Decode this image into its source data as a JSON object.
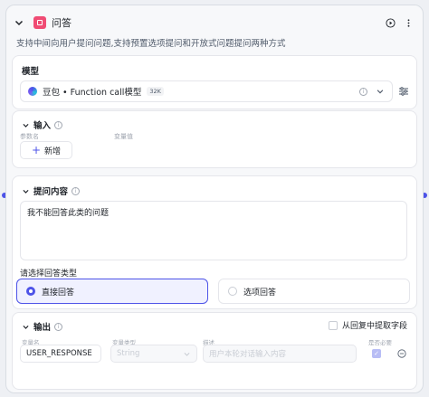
{
  "node": {
    "title": "问答",
    "description": "支持中间向用户提问问题,支持预置选项提问和开放式问题提问两种方式"
  },
  "model": {
    "section_title": "模型",
    "name": "豆包 • Function call模型",
    "context_badge": "32K"
  },
  "input": {
    "section_title": "输入",
    "col_param_name": "参数名",
    "col_variable_value": "变量值",
    "add_button": "新增"
  },
  "question": {
    "section_title": "提问内容",
    "content": "我不能回答此类的问题",
    "answer_type_label": "请选择回答类型",
    "options": [
      {
        "label": "直接回答",
        "selected": true
      },
      {
        "label": "选项回答",
        "selected": false
      }
    ]
  },
  "output": {
    "section_title": "输出",
    "extract_label": "从回复中提取字段",
    "col_var_name": "变量名",
    "col_var_type": "变量类型",
    "col_desc": "描述",
    "col_required": "是否必要",
    "var_name": "USER_RESPONSE",
    "var_type": "String",
    "desc_placeholder": "用户本轮对话输入内容"
  },
  "colors": {
    "accent": "#4d53e8",
    "node_icon": "#f04c74"
  }
}
